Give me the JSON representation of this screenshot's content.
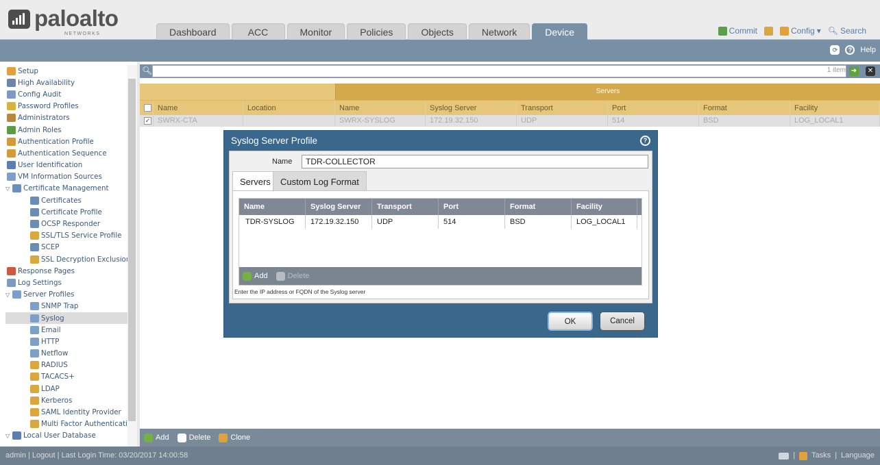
{
  "brand": {
    "name": "paloalto",
    "sub": "NETWORKS"
  },
  "tabs": [
    "Dashboard",
    "ACC",
    "Monitor",
    "Policies",
    "Objects",
    "Network",
    "Device"
  ],
  "active_tab": "Device",
  "top_actions": {
    "commit": "Commit",
    "config": "Config",
    "search": "Search"
  },
  "toolbar": {
    "help": "Help"
  },
  "sidebar": {
    "items": [
      {
        "label": "Setup",
        "indent": 0,
        "color": "#e3a13a"
      },
      {
        "label": "High Availability",
        "indent": 0,
        "color": "#6d86a8"
      },
      {
        "label": "Config Audit",
        "indent": 0,
        "color": "#7d9ac0"
      },
      {
        "label": "Password Profiles",
        "indent": 0,
        "color": "#d9b23d"
      },
      {
        "label": "Administrators",
        "indent": 0,
        "color": "#b8873e"
      },
      {
        "label": "Admin Roles",
        "indent": 0,
        "color": "#5e9a45"
      },
      {
        "label": "Authentication Profile",
        "indent": 0,
        "color": "#d49a3a"
      },
      {
        "label": "Authentication Sequence",
        "indent": 0,
        "color": "#d49a3a"
      },
      {
        "label": "User Identification",
        "indent": 0,
        "color": "#5b7fb2"
      },
      {
        "label": "VM Information Sources",
        "indent": 0,
        "color": "#7ea0c8"
      },
      {
        "label": "Certificate Management",
        "indent": 0,
        "color": "#6b8fbf",
        "expand": true
      },
      {
        "label": "Certificates",
        "indent": 1,
        "color": "#6d8cb5"
      },
      {
        "label": "Certificate Profile",
        "indent": 1,
        "color": "#6d8cb5"
      },
      {
        "label": "OCSP Responder",
        "indent": 1,
        "color": "#6d8cb5"
      },
      {
        "label": "SSL/TLS Service Profile",
        "indent": 1,
        "color": "#d9a640"
      },
      {
        "label": "SCEP",
        "indent": 1,
        "color": "#6d8cb5"
      },
      {
        "label": "SSL Decryption Exclusion",
        "indent": 1,
        "color": "#d9a640"
      },
      {
        "label": "Response Pages",
        "indent": 0,
        "color": "#d0573d"
      },
      {
        "label": "Log Settings",
        "indent": 0,
        "color": "#7d9ac0"
      },
      {
        "label": "Server Profiles",
        "indent": 0,
        "color": "#7da0c8",
        "expand": true
      },
      {
        "label": "SNMP Trap",
        "indent": 1,
        "color": "#7da0c8"
      },
      {
        "label": "Syslog",
        "indent": 1,
        "color": "#7da0c8",
        "selected": true
      },
      {
        "label": "Email",
        "indent": 1,
        "color": "#7da0c8"
      },
      {
        "label": "HTTP",
        "indent": 1,
        "color": "#7da0c8"
      },
      {
        "label": "Netflow",
        "indent": 1,
        "color": "#7da0c8"
      },
      {
        "label": "RADIUS",
        "indent": 1,
        "color": "#d9a640"
      },
      {
        "label": "TACACS+",
        "indent": 1,
        "color": "#d9a640"
      },
      {
        "label": "LDAP",
        "indent": 1,
        "color": "#d9a640"
      },
      {
        "label": "Kerberos",
        "indent": 1,
        "color": "#d9a640"
      },
      {
        "label": "SAML Identity Provider",
        "indent": 1,
        "color": "#d9a640"
      },
      {
        "label": "Multi Factor Authenticatio",
        "indent": 1,
        "color": "#d9a640"
      },
      {
        "label": "Local User Database",
        "indent": 0,
        "color": "#5b7fb2",
        "expand": true
      }
    ]
  },
  "search": {
    "count": "1 item"
  },
  "grid": {
    "group_header": "Servers",
    "columns": [
      "Name",
      "Location",
      "Name",
      "Syslog Server",
      "Transport",
      "Port",
      "Format",
      "Facility"
    ],
    "rows": [
      [
        "SWRX-CTA",
        "",
        "SWRX-SYSLOG",
        "172.19.32.150",
        "UDP",
        "514",
        "BSD",
        "LOG_LOCAL1"
      ]
    ]
  },
  "bottom_actions": {
    "add": "Add",
    "delete": "Delete",
    "clone": "Clone"
  },
  "footer": {
    "status": "admin | Logout | Last Login Time: 03/20/2017 14:00:58",
    "tasks": "Tasks",
    "language": "Language"
  },
  "dialog": {
    "title": "Syslog Server Profile",
    "name_label": "Name",
    "name_value": "TDR-COLLECTOR",
    "tabs": [
      "Servers",
      "Custom Log Format"
    ],
    "columns": [
      "Name",
      "Syslog Server",
      "Transport",
      "Port",
      "Format",
      "Facility"
    ],
    "rows": [
      [
        "TDR-SYSLOG",
        "172.19.32.150",
        "UDP",
        "514",
        "BSD",
        "LOG_LOCAL1"
      ]
    ],
    "add": "Add",
    "delete": "Delete",
    "hint": "Enter the IP address or FQDN of the Syslog server",
    "ok": "OK",
    "cancel": "Cancel"
  }
}
